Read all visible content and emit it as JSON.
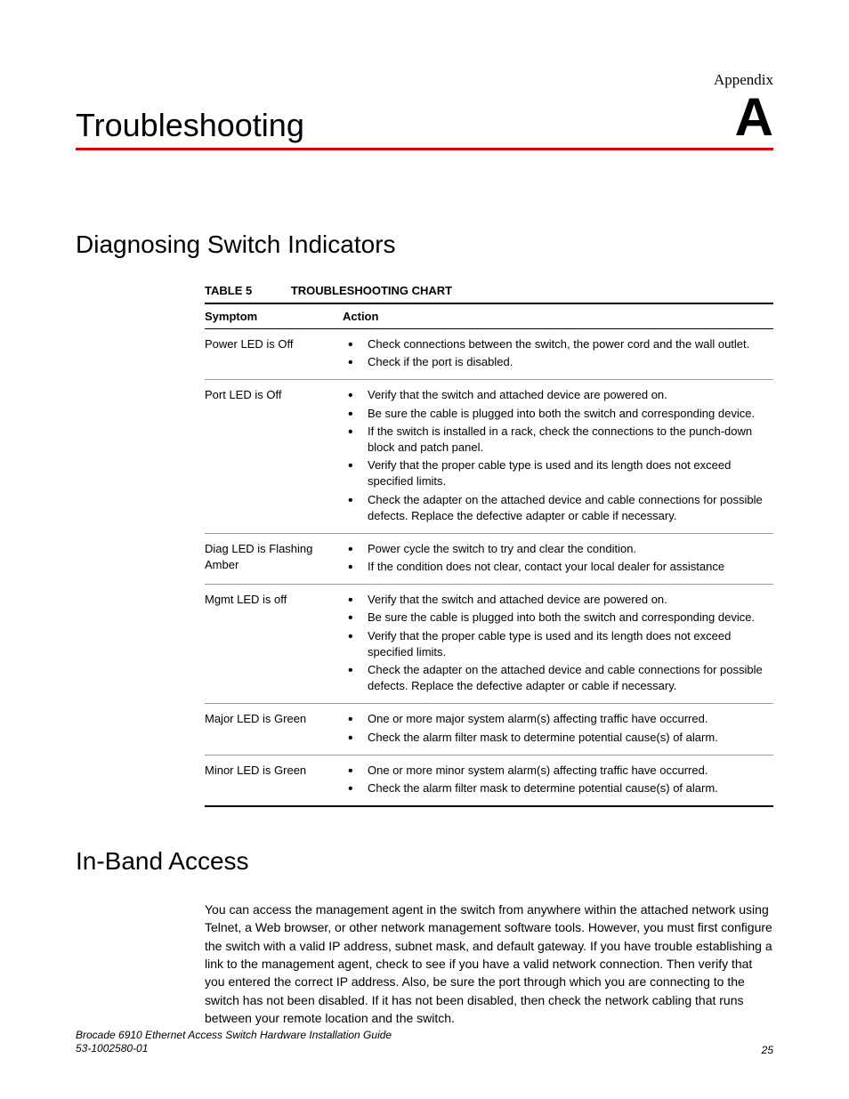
{
  "header": {
    "label": "Appendix",
    "chapter_title": "Troubleshooting",
    "chapter_letter": "A"
  },
  "section1": {
    "heading": "Diagnosing Switch Indicators",
    "table": {
      "caption_label": "TABLE 5",
      "caption_title": "TROUBLESHOOTING CHART",
      "columns": [
        "Symptom",
        "Action"
      ],
      "rows": [
        {
          "symptom": "Power LED is Off",
          "actions": [
            "Check connections between the switch, the power cord and the wall outlet.",
            "Check if the port is disabled."
          ]
        },
        {
          "symptom": "Port LED is Off",
          "actions": [
            "Verify that the switch and attached device are powered on.",
            "Be sure the cable is plugged into both the switch and corresponding device.",
            "If the switch is installed in a rack, check the connections to the punch-down block and patch panel.",
            "Verify that the proper cable type is used and its length does not exceed specified limits.",
            "Check the adapter on the attached device and cable connections for possible defects. Replace the defective adapter or cable if necessary."
          ]
        },
        {
          "symptom": "Diag LED is Flashing Amber",
          "actions": [
            "Power cycle the switch to try and clear the condition.",
            "If the condition does not clear, contact your local dealer for assistance"
          ]
        },
        {
          "symptom": "Mgmt LED is off",
          "actions": [
            "Verify that the switch and attached device are powered on.",
            "Be sure the cable is plugged into both the switch and corresponding device.",
            "Verify that the proper cable type is used and its length does not exceed specified limits.",
            "Check the adapter on the attached device and cable connections for possible defects. Replace the defective adapter or cable if necessary."
          ]
        },
        {
          "symptom": "Major LED is Green",
          "actions": [
            "One or more major system alarm(s) affecting traffic have occurred.",
            "Check the alarm filter mask to determine potential cause(s) of alarm."
          ]
        },
        {
          "symptom": "Minor LED is Green",
          "actions": [
            "One or more minor system alarm(s) affecting traffic have occurred.",
            "Check the alarm filter mask to determine potential cause(s) of alarm."
          ]
        }
      ]
    }
  },
  "section2": {
    "heading": "In-Band Access",
    "paragraph": "You can access the management agent in the switch from anywhere within the attached network using Telnet, a Web browser, or other network management software tools. However, you must first configure the switch with a valid IP address, subnet mask, and default gateway. If you have trouble establishing a link to the management agent, check to see if you have a valid network connection. Then verify that you entered the correct IP address. Also, be sure the port through which you are connecting to the switch has not been disabled. If it has not been disabled, then check the network cabling that runs between your remote location and the switch."
  },
  "footer": {
    "doc_title": "Brocade 6910 Ethernet Access Switch Hardware Installation Guide",
    "doc_number": "53-1002580-01",
    "page_number": "25"
  }
}
